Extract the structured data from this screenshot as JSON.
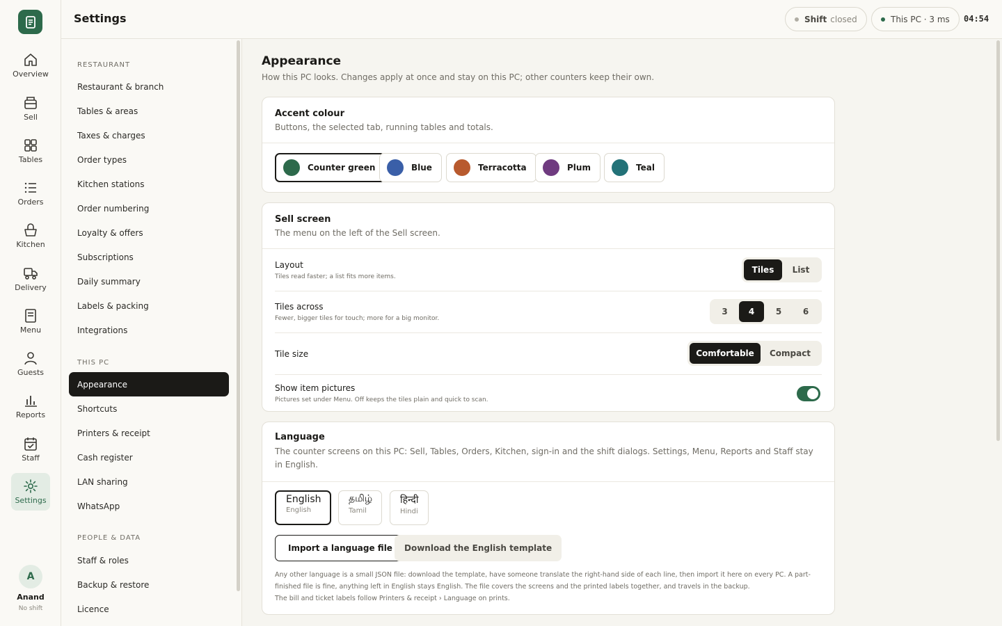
{
  "app": {
    "page_title": "Settings",
    "shift_status": {
      "label": "Shift",
      "state": "closed"
    },
    "pc_status": "This PC · 3 ms",
    "clock": "04:54"
  },
  "rail": {
    "items": [
      {
        "label": "Overview",
        "icon": "home-icon"
      },
      {
        "label": "Sell",
        "icon": "register-icon"
      },
      {
        "label": "Tables",
        "icon": "grid-icon"
      },
      {
        "label": "Orders",
        "icon": "list-icon"
      },
      {
        "label": "Kitchen",
        "icon": "basket-icon"
      },
      {
        "label": "Delivery",
        "icon": "delivery-icon"
      },
      {
        "label": "Menu",
        "icon": "menu-icon"
      },
      {
        "label": "Guests",
        "icon": "user-icon"
      },
      {
        "label": "Reports",
        "icon": "bar-chart-icon"
      },
      {
        "label": "Staff",
        "icon": "calendar-icon"
      },
      {
        "label": "Settings",
        "icon": "gear-icon"
      }
    ],
    "active": "Settings",
    "user": {
      "initial": "A",
      "name": "Anand",
      "status": "No shift"
    }
  },
  "settings_nav": {
    "sections": [
      {
        "heading": "RESTAURANT",
        "items": [
          "Restaurant & branch",
          "Tables & areas",
          "Taxes & charges",
          "Order types",
          "Kitchen stations",
          "Order numbering",
          "Loyalty & offers",
          "Subscriptions",
          "Daily summary",
          "Labels & packing",
          "Integrations"
        ]
      },
      {
        "heading": "THIS PC",
        "items": [
          "Appearance",
          "Shortcuts",
          "Printers & receipt",
          "Cash register",
          "LAN sharing",
          "WhatsApp"
        ]
      },
      {
        "heading": "PEOPLE & DATA",
        "items": [
          "Staff & roles",
          "Backup & restore",
          "Licence"
        ]
      }
    ],
    "active": "Appearance"
  },
  "appearance": {
    "title": "Appearance",
    "subtitle": "How this PC looks. Changes apply at once and stay on this PC; other counters keep their own.",
    "accent": {
      "title": "Accent colour",
      "subtitle": "Buttons, the selected tab, running tables and totals.",
      "options": [
        {
          "label": "Counter green",
          "color": "#2d6a4b",
          "selected": true
        },
        {
          "label": "Blue",
          "color": "#3a5fa8",
          "selected": false
        },
        {
          "label": "Terracotta",
          "color": "#b85a2e",
          "selected": false
        },
        {
          "label": "Plum",
          "color": "#6f3b80",
          "selected": false
        },
        {
          "label": "Teal",
          "color": "#237278",
          "selected": false
        }
      ]
    },
    "sell_screen": {
      "title": "Sell screen",
      "subtitle": "The menu on the left of the Sell screen.",
      "layout": {
        "label": "Layout",
        "help": "Tiles read faster; a list fits more items.",
        "options": [
          "Tiles",
          "List"
        ],
        "selected": "Tiles"
      },
      "tiles_across": {
        "label": "Tiles across",
        "help": "Fewer, bigger tiles for touch; more for a big monitor.",
        "options": [
          "3",
          "4",
          "5",
          "6"
        ],
        "selected": "4"
      },
      "tile_size": {
        "label": "Tile size",
        "options": [
          "Comfortable",
          "Compact"
        ],
        "selected": "Comfortable"
      },
      "show_pictures": {
        "label": "Show item pictures",
        "help": "Pictures set under Menu. Off keeps the tiles plain and quick to scan.",
        "on": true
      }
    },
    "language": {
      "title": "Language",
      "subtitle": "The counter screens on this PC: Sell, Tables, Orders, Kitchen, sign-in and the shift dialogs. Settings, Menu, Reports and Staff stay in English.",
      "options": [
        {
          "native": "English",
          "english": "English",
          "selected": true
        },
        {
          "native": "தமிழ்",
          "english": "Tamil",
          "selected": false
        },
        {
          "native": "हिन्दी",
          "english": "Hindi",
          "selected": false
        }
      ],
      "import_button": "Import a language file",
      "download_button": "Download the English template",
      "note": "Any other language is a small JSON file: download the template, have someone translate the right-hand side of each line, then import it here on every PC. A part-finished file is fine, anything left in English stays English. The file covers the screens and the printed labels together, and travels in the backup.",
      "note2": "The bill and ticket labels follow Printers & receipt › Language on prints."
    }
  }
}
